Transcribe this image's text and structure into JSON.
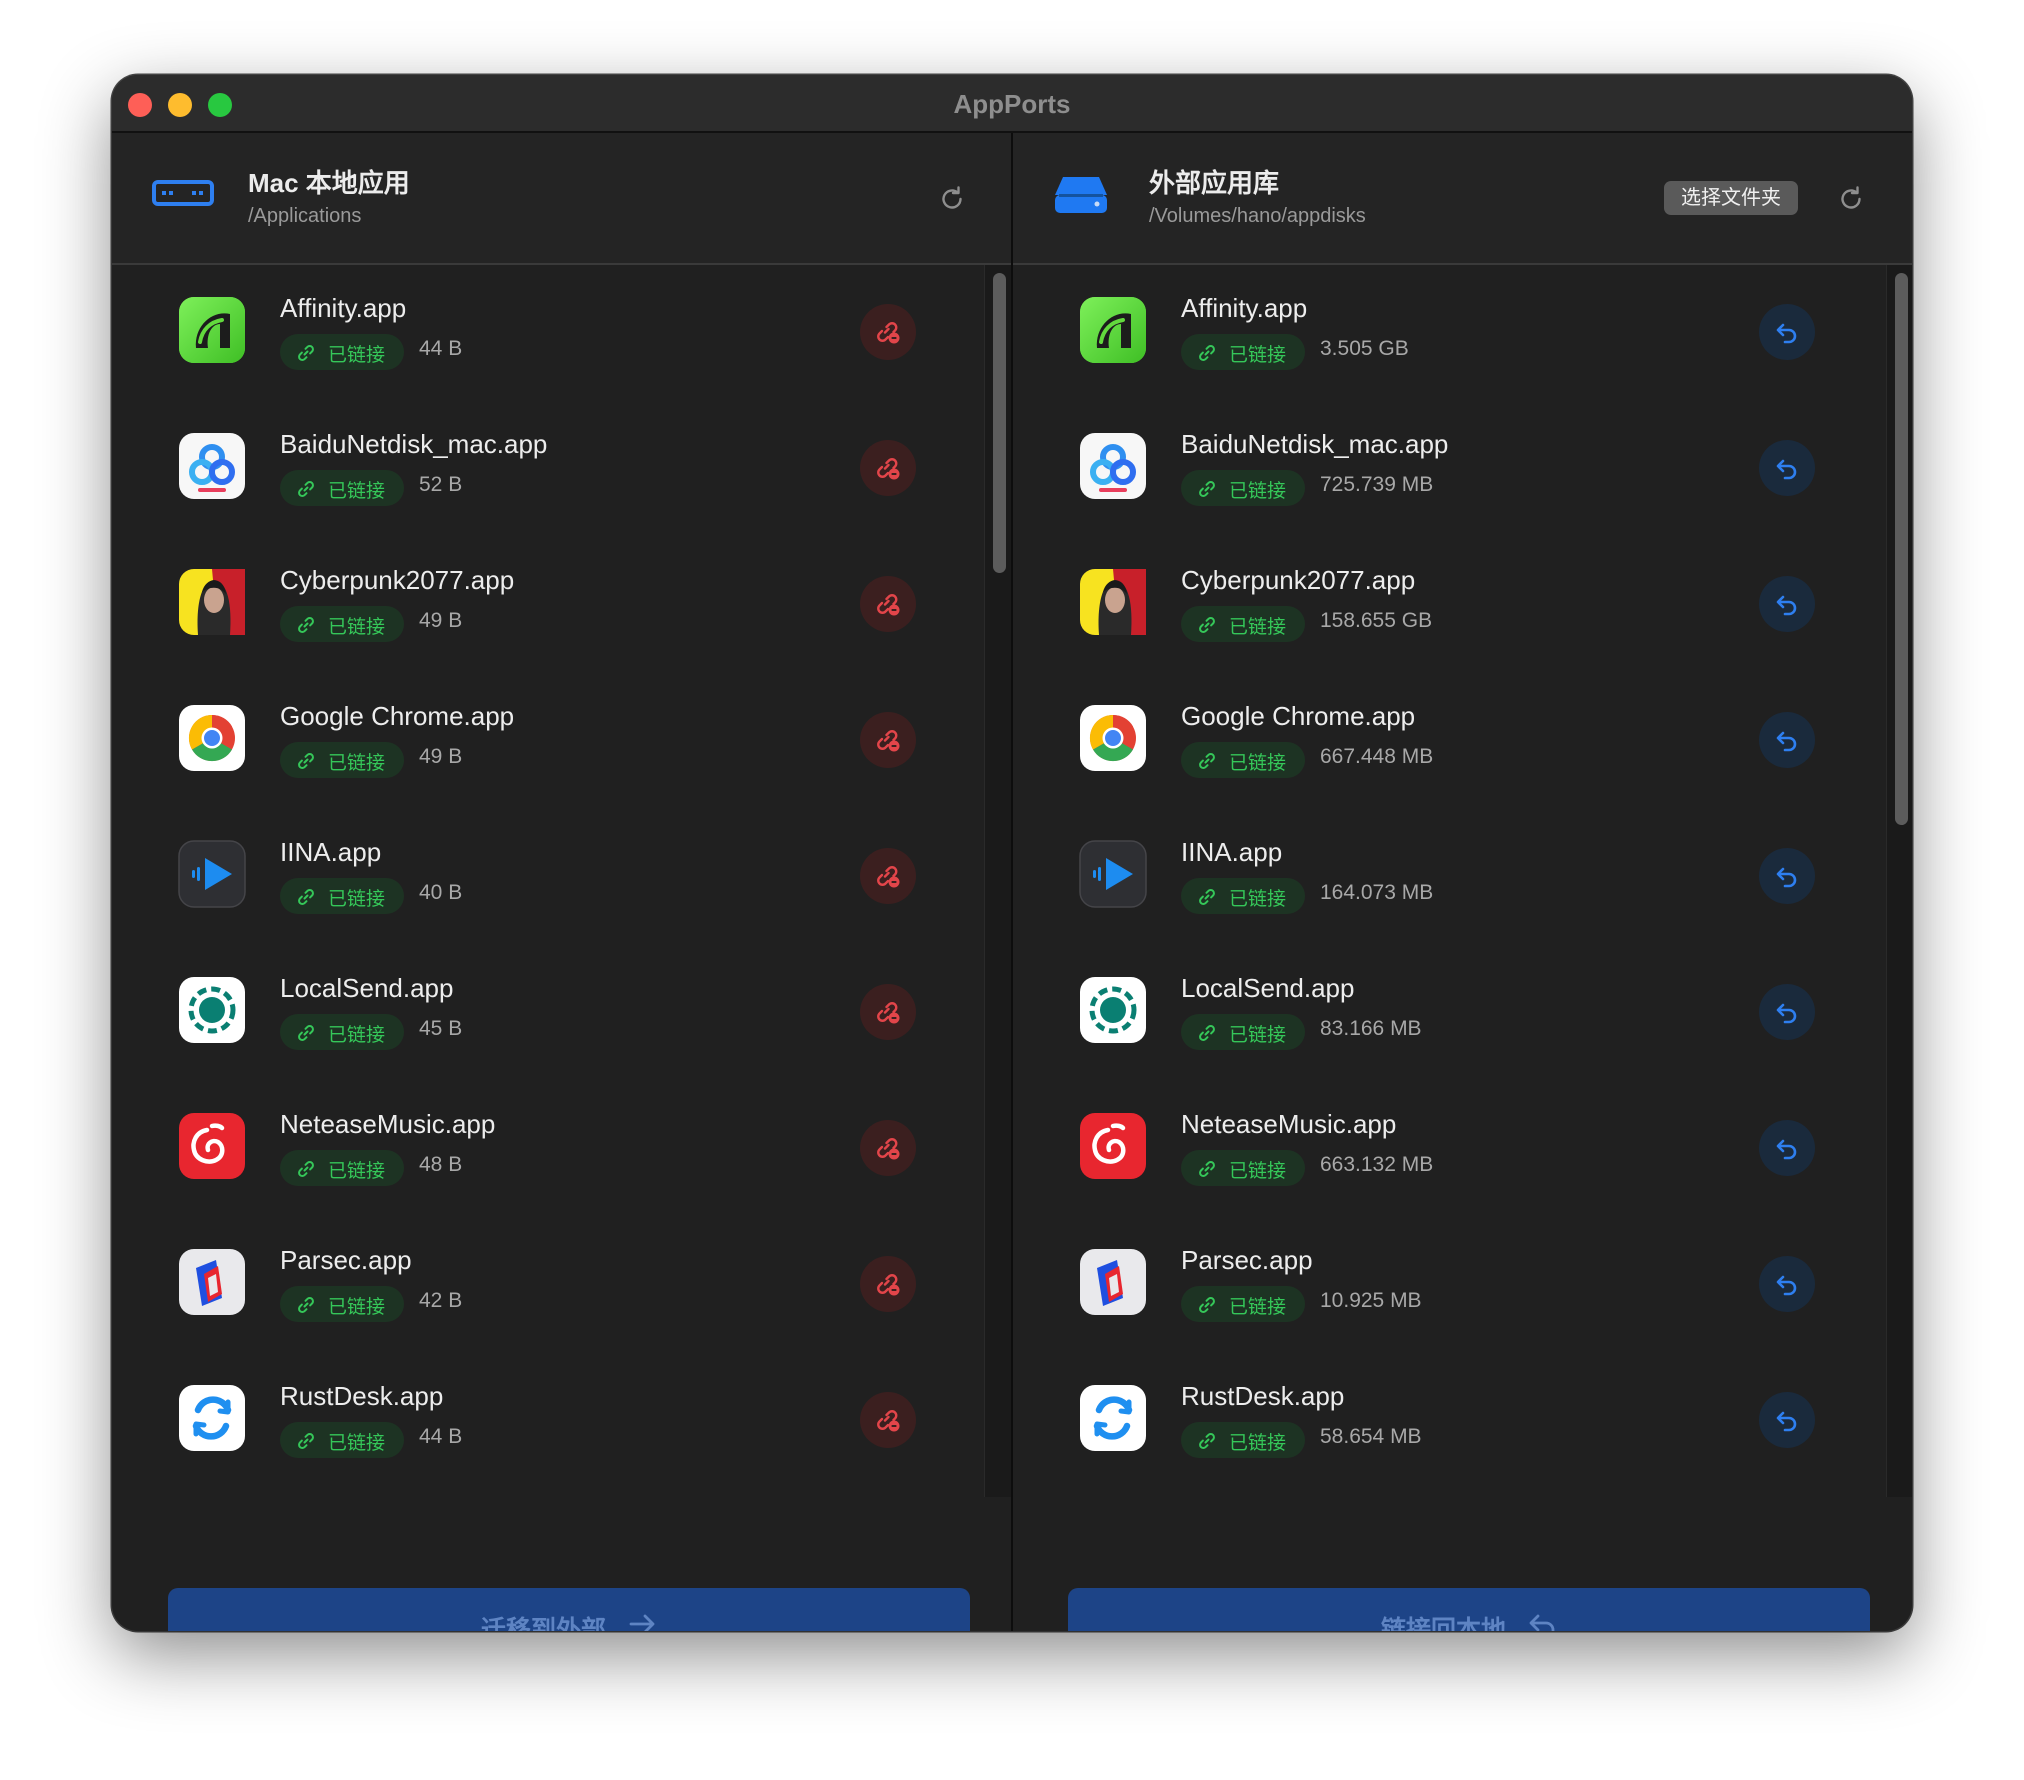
{
  "window": {
    "title": "AppPorts"
  },
  "colors": {
    "linked_green": "#35c759",
    "unlink_red": "#e2454a",
    "link_blue": "#2e7ff0",
    "primary_button": "#1d4487"
  },
  "left_panel": {
    "icon": "drive-icon",
    "title": "Mac 本地应用",
    "path": "/Applications",
    "action_label": "迁移到外部",
    "apps": [
      {
        "name": "Affinity.app",
        "status": "已链接",
        "size": "44 B"
      },
      {
        "name": "BaiduNetdisk_mac.app",
        "status": "已链接",
        "size": "52 B"
      },
      {
        "name": "Cyberpunk2077.app",
        "status": "已链接",
        "size": "49 B"
      },
      {
        "name": "Google Chrome.app",
        "status": "已链接",
        "size": "49 B"
      },
      {
        "name": "IINA.app",
        "status": "已链接",
        "size": "40 B"
      },
      {
        "name": "LocalSend.app",
        "status": "已链接",
        "size": "45 B"
      },
      {
        "name": "NeteaseMusic.app",
        "status": "已链接",
        "size": "48 B"
      },
      {
        "name": "Parsec.app",
        "status": "已链接",
        "size": "42 B"
      },
      {
        "name": "RustDesk.app",
        "status": "已链接",
        "size": "44 B"
      }
    ]
  },
  "right_panel": {
    "icon": "external-drive-icon",
    "title": "外部应用库",
    "path": "/Volumes/hano/appdisks",
    "choose_folder_label": "选择文件夹",
    "action_label": "链接回本地",
    "apps": [
      {
        "name": "Affinity.app",
        "status": "已链接",
        "size": "3.505 GB"
      },
      {
        "name": "BaiduNetdisk_mac.app",
        "status": "已链接",
        "size": "725.739 MB"
      },
      {
        "name": "Cyberpunk2077.app",
        "status": "已链接",
        "size": "158.655 GB"
      },
      {
        "name": "Google Chrome.app",
        "status": "已链接",
        "size": "667.448 MB"
      },
      {
        "name": "IINA.app",
        "status": "已链接",
        "size": "164.073 MB"
      },
      {
        "name": "LocalSend.app",
        "status": "已链接",
        "size": "83.166 MB"
      },
      {
        "name": "NeteaseMusic.app",
        "status": "已链接",
        "size": "663.132 MB"
      },
      {
        "name": "Parsec.app",
        "status": "已链接",
        "size": "10.925 MB"
      },
      {
        "name": "RustDesk.app",
        "status": "已链接",
        "size": "58.654 MB"
      }
    ]
  },
  "app_icons": [
    "affinity-icon",
    "baidu-netdisk-icon",
    "cyberpunk-icon",
    "chrome-icon",
    "iina-icon",
    "localsend-icon",
    "netease-music-icon",
    "parsec-icon",
    "rustdesk-icon"
  ]
}
